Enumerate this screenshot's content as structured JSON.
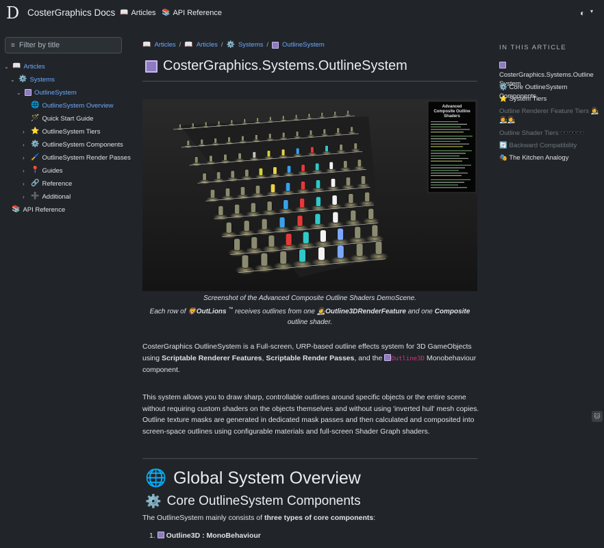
{
  "header": {
    "logo": "D",
    "brand": "CosterGraphics Docs",
    "nav": [
      {
        "icon": "📖",
        "label": "Articles"
      },
      {
        "icon": "📚",
        "label": "API Reference"
      }
    ],
    "theme_icon": "◐",
    "theme_caret": "▾"
  },
  "sidebar": {
    "filter_placeholder": "Filter by title",
    "filter_icon": "≡",
    "items": [
      {
        "label": "Articles",
        "icon": "📖",
        "chev": "⌄"
      },
      {
        "label": "Systems",
        "icon": "⚙️",
        "chev": "⌄"
      },
      {
        "label": "OutlineSystem",
        "icon": "",
        "chev": "⌄"
      },
      {
        "label": "OutlineSystem Overview",
        "icon": "🌐",
        "chev": ""
      },
      {
        "label": "Quick Start Guide",
        "icon": "🪄",
        "chev": ""
      },
      {
        "label": "OutlineSystem Tiers",
        "icon": "⭐",
        "chev": "›"
      },
      {
        "label": "OutlineSystem Components",
        "icon": "⚙️",
        "chev": "›"
      },
      {
        "label": "OutlineSystem Render Passes",
        "icon": "🖌️",
        "chev": "›"
      },
      {
        "label": "Guides",
        "icon": "📍",
        "chev": "›"
      },
      {
        "label": "Reference",
        "icon": "🔗",
        "chev": "›"
      },
      {
        "label": "Additional",
        "icon": "➕",
        "chev": "›"
      },
      {
        "label": "API Reference",
        "icon": "📚",
        "chev": ""
      }
    ]
  },
  "breadcrumb": [
    {
      "icon": "📖",
      "label": "Articles"
    },
    {
      "icon": "📖",
      "label": "Articles"
    },
    {
      "icon": "⚙️",
      "label": "Systems"
    },
    {
      "icon": "",
      "label": "OutlineSystem"
    }
  ],
  "breadcrumb_sep": "/",
  "page_title": "CosterGraphics.Systems.OutlineSystem",
  "hero": {
    "panel_title_1": "Advanced",
    "panel_title_2": "Composite Outline",
    "panel_title_3": "Shaders"
  },
  "caption": {
    "line1": "Screenshot of the Advanced Composite Outline Shaders DemoScene.",
    "l2_a": "Each row of ",
    "l2_icon1": "🦁",
    "l2_b": "OutLions",
    "l2_tm": "™",
    "l2_c": " receives outlines from one ",
    "l2_icon2": "👩‍🎨",
    "l2_d": "Outline3DRenderFeature",
    "l2_e": " and one ",
    "l2_f": "Composite",
    "line3": "outline shader."
  },
  "intro": {
    "a": "CosterGraphics OutlineSystem is a Full-screen, URP-based outline effects system for 3D GameObjects using ",
    "b": "Scriptable Renderer Features",
    "c": ", ",
    "d": "Scriptable Render Passes",
    "e": ", and the ",
    "code": "Outline3D",
    "f": " Monobehaviour component."
  },
  "para2": "This system allows you to draw sharp, controllable outlines around specific objects or the entire scene without requiring custom shaders on the objects themselves and without using 'inverted hull' mesh copies. Outline texture masks are generated in dedicated mask passes and then calculated and composited into screen-space outlines using configurable materials and full-screen Shader Graph shaders.",
  "h1": {
    "icon": "🌐",
    "text": "Global System Overview"
  },
  "h2": {
    "icon": "⚙️",
    "text": "Core OutlineSystem Components"
  },
  "core_para": {
    "a": "The OutlineSystem mainly consists of ",
    "b": "three types of core components",
    "c": ":"
  },
  "list_item": {
    "num": "1.",
    "text": "Outline3D : MonoBehaviour"
  },
  "toc": {
    "heading": "IN THIS ARTICLE",
    "items": [
      {
        "icon": "",
        "label": "CosterGraphics.Systems.Outline System"
      },
      {
        "icon": "⚙️",
        "label": "Core OutlineSystem Components"
      },
      {
        "icon": "⭐",
        "label": "System Tiers"
      },
      {
        "icon": "",
        "label": "Outline Renderer Feature Tiers 👩‍🎨👩‍🎨👩‍🎨"
      },
      {
        "icon": "",
        "label": "Outline Shader Tiers 🕶️🕶️🕶️"
      },
      {
        "icon": "🔄",
        "label": "Backward Compatibility"
      },
      {
        "icon": "🎭",
        "label": "The Kitchen Analogy"
      }
    ]
  },
  "side_badge": "🐱",
  "colors": {
    "bg": "#212529",
    "link": "#6ea8fe",
    "text": "#dee2e6",
    "muted": "#6c757d",
    "code": "#d63384",
    "accent": "#8e7bbf"
  }
}
